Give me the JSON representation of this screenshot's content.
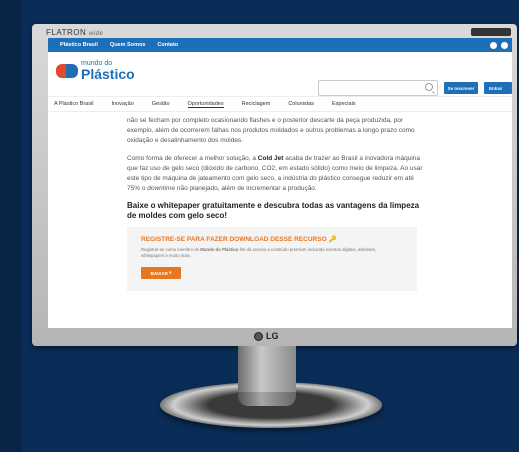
{
  "monitor": {
    "brand": "FLATRON",
    "brand_suffix": "wide",
    "logo": "LG"
  },
  "topbar": {
    "items": [
      "Plástico Brasil",
      "Quem Somos",
      "Contato"
    ]
  },
  "site": {
    "logo_line1": "mundo do",
    "logo_line2": "Plástico",
    "search_placeholder": "",
    "subscribe_label": "Se Inscrever",
    "login_label": "Entrar"
  },
  "nav": {
    "items": [
      {
        "label": "A Plástico Brasil"
      },
      {
        "label": "Inovação"
      },
      {
        "label": "Gestão"
      },
      {
        "label": "Oportunidades"
      },
      {
        "label": "Reciclagem"
      },
      {
        "label": "Colunistas"
      },
      {
        "label": "Especiais"
      }
    ]
  },
  "article": {
    "p1": "não se fecham por completo ocasionando flashes e o posterior descarte da peça produzida, por exemplo, além de ocorrerem falhas nos produtos moldados e outros problemas a longo prazo como oxidação e desalinhamento dos moldes.",
    "p2_a": "Como forma de oferecer a melhor solução, a ",
    "p2_b": "Cold Jet",
    "p2_c": " acaba de trazer ao Brasil a inovadora máquina que faz uso de gelo seco (dióxido de carbono, CO2, em estado sólido) como meio de limpeza. Ao usar este tipo de máquina de jateamento com gelo seco, a indústria do plástico consegue reduzir em até 75% o ",
    "p2_d": "downtime",
    "p2_e": " não planejado, além de incrementar a produção.",
    "heading": "Baixe o whitepaper gratuitamente e descubra todas as vantagens da limpeza de moldes com gelo seco!"
  },
  "cta": {
    "title": "REGISTRE-SE PARA FAZER DOWNLOAD DESSE RECURSO",
    "text_a": "Registrar-se como membro de ",
    "text_b": "Mundo do Plástico",
    "text_c": " lhe dá acesso a conteúdo premium incluindo eventos digitais, webinars, whitepapers e muito mais.",
    "button": "BAIXAR"
  },
  "colors": {
    "accent_blue": "#1e6fb8",
    "accent_orange": "#e87722",
    "background": "#0a2d57"
  }
}
